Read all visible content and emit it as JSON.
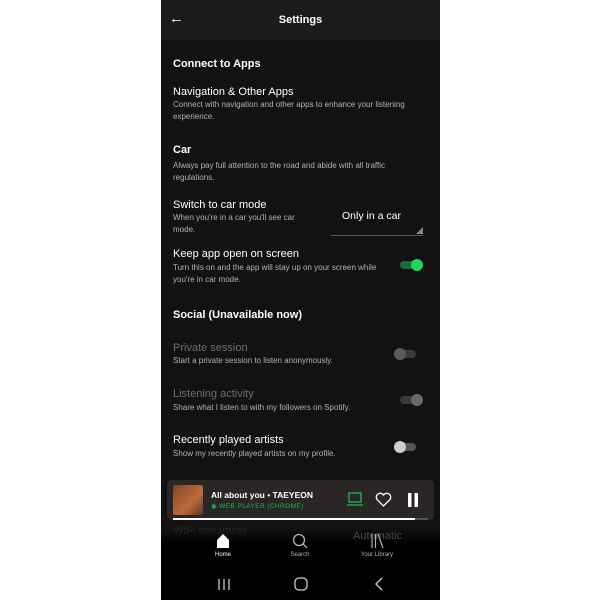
{
  "header": {
    "title": "Settings",
    "back_icon": "arrow-left-icon"
  },
  "sections": {
    "connect": {
      "title": "Connect to Apps"
    },
    "nav_apps": {
      "title": "Navigation & Other Apps",
      "desc": "Connect with navigation and other apps to enhance your listening experience."
    },
    "car": {
      "title": "Car",
      "desc": "Always pay full attention to the road and abide with all traffic regulations."
    },
    "car_mode": {
      "title": "Switch to car mode",
      "desc": "When you're in a car you'll see car mode.",
      "value": "Only in a car"
    },
    "keep_open": {
      "title": "Keep app open on screen",
      "desc": "Turn this on and the app will stay up on your screen while you're in car mode.",
      "on": true
    },
    "social": {
      "title": "Social (Unavailable now)"
    },
    "private": {
      "title": "Private session",
      "desc": "Start a private session to listen anonymously.",
      "on": false
    },
    "listening": {
      "title": "Listening activity",
      "desc": "Share what I listen to with my followers on Spotify.",
      "on": true
    },
    "recent": {
      "title": "Recently played artists",
      "desc": "Show my recently played artists on my profile.",
      "on": false
    },
    "wifi": {
      "title": "WiFi streaming",
      "value": "Automatic"
    }
  },
  "player": {
    "track": "All about you • TAEYEON",
    "device": "WEB PLAYER (CHROME)",
    "progress": 0.95
  },
  "bottom_nav": [
    {
      "label": "Home"
    },
    {
      "label": "Search"
    },
    {
      "label": "Your Library"
    }
  ],
  "colors": {
    "accent": "#1db954",
    "background": "#121212"
  }
}
